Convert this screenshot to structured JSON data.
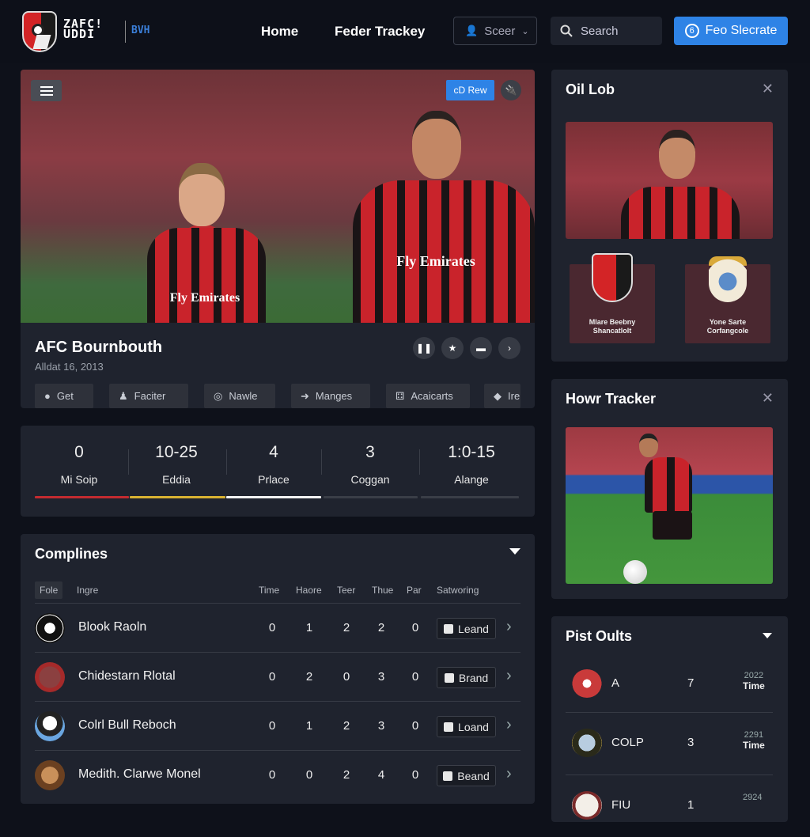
{
  "header": {
    "logo_text_1": "ZAFC!",
    "logo_text_2": "UDDI",
    "logo_sub": "BVH",
    "nav": [
      "Home",
      "Feder Trackey"
    ],
    "user_select": "Sceer",
    "search_placeholder": "Search",
    "cta_label": "Feo Slecrate",
    "cta_icon": "6"
  },
  "hero": {
    "top_button": "cD Rew",
    "title": "AFC Bournbouth",
    "date": "Alldat 16, 2013",
    "jersey_text": "Fly Emirates",
    "actions": [
      "pause-icon",
      "star-icon",
      "hand-icon",
      "arrow-right-icon"
    ],
    "chips": [
      {
        "icon": "●",
        "label": "Get"
      },
      {
        "icon": "♟",
        "label": "Faciter"
      },
      {
        "icon": "◎",
        "label": "Nawle"
      },
      {
        "icon": "➜",
        "label": "Manges"
      },
      {
        "icon": "⚃",
        "label": "Acaicarts"
      },
      {
        "icon": "◆",
        "label": "Irei"
      }
    ]
  },
  "stats": {
    "items": [
      {
        "value": "0",
        "label": "Mi Soip",
        "color": "#c42b30",
        "active": true
      },
      {
        "value": "10-25",
        "label": "Eddia",
        "color": "#d9b232",
        "active": true
      },
      {
        "value": "4",
        "label": "Prlace",
        "color": "#f2f2f2",
        "active": true
      },
      {
        "value": "3",
        "label": "Coggan",
        "color": "#3a3e47",
        "active": false
      },
      {
        "value": "1:0-15",
        "label": "Alange",
        "color": "#3a3e47",
        "active": false
      }
    ]
  },
  "complines": {
    "title": "Complines",
    "headers": {
      "file": "Fole",
      "name": "Ingre",
      "cols": [
        "Time",
        "Haore",
        "Teer",
        "Thue",
        "Par"
      ],
      "last": "Satworing"
    },
    "rows": [
      {
        "name": "Blook Raoln",
        "vals": [
          "0",
          "1",
          "2",
          "2",
          "0"
        ],
        "tag": "Leand"
      },
      {
        "name": "Chidestarn Rlotal",
        "vals": [
          "0",
          "2",
          "0",
          "3",
          "0"
        ],
        "tag": "Brand"
      },
      {
        "name": "Colrl Bull Reboch",
        "vals": [
          "0",
          "1",
          "2",
          "3",
          "0"
        ],
        "tag": "Loand"
      },
      {
        "name": "Medith. Clarwe Monel",
        "vals": [
          "0",
          "0",
          "2",
          "4",
          "0"
        ],
        "tag": "Beand"
      }
    ]
  },
  "oil_lob": {
    "title": "Oil Lob",
    "crests": [
      {
        "label_1": "Mlare Beebny",
        "label_2": "Shancatlolt"
      },
      {
        "label_1": "Yone Sarte",
        "label_2": "Corfangcole"
      }
    ]
  },
  "howr_tracker": {
    "title": "Howr Tracker"
  },
  "pist_oults": {
    "title": "Pist Oults",
    "rows": [
      {
        "name": "A",
        "num": "7",
        "year": "2022",
        "unit": "Time"
      },
      {
        "name": "COLP",
        "num": "3",
        "year": "2291",
        "unit": "Time"
      },
      {
        "name": "FIU",
        "num": "1",
        "year": "2924",
        "unit": ""
      }
    ]
  }
}
